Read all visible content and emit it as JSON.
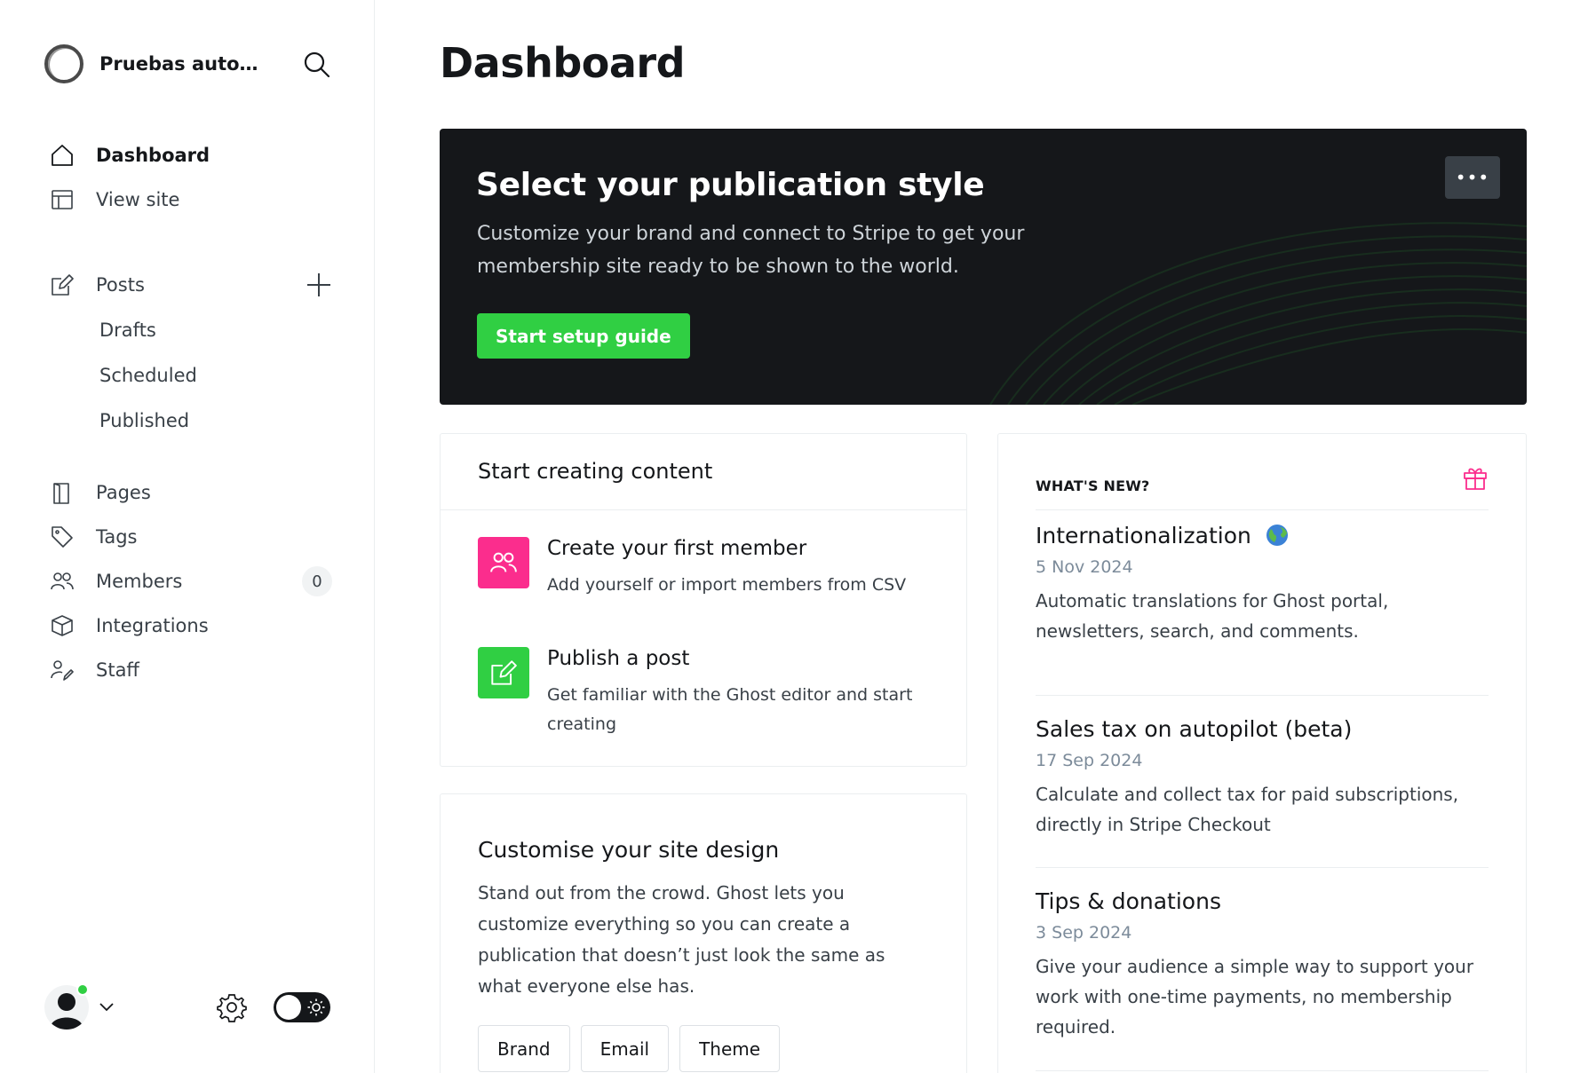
{
  "sidebar": {
    "site_name": "Pruebas automa...",
    "items": [
      {
        "label": "Dashboard",
        "icon": "home-icon"
      },
      {
        "label": "View site",
        "icon": "layout-icon"
      },
      {
        "label": "Posts",
        "icon": "edit-icon"
      },
      {
        "label": "Drafts"
      },
      {
        "label": "Scheduled"
      },
      {
        "label": "Published"
      },
      {
        "label": "Pages",
        "icon": "page-icon"
      },
      {
        "label": "Tags",
        "icon": "tag-icon"
      },
      {
        "label": "Members",
        "icon": "members-icon",
        "count": "0"
      },
      {
        "label": "Integrations",
        "icon": "cube-icon"
      },
      {
        "label": "Staff",
        "icon": "staff-icon"
      }
    ]
  },
  "main": {
    "title": "Dashboard",
    "hero": {
      "title": "Select your publication style",
      "description": "Customize your brand and connect to Stripe to get your membership site ready to be shown to the world.",
      "cta": "Start setup guide",
      "more": "•••"
    },
    "start_card": {
      "title": "Start creating content",
      "tasks": [
        {
          "title": "Create your first member",
          "description": "Add yourself or import members from CSV"
        },
        {
          "title": "Publish a post",
          "description": "Get familiar with the Ghost editor and start creating"
        }
      ]
    },
    "design_card": {
      "title": "Customise your site design",
      "description": "Stand out from the crowd. Ghost lets you customize everything so you can create a publication that doesn’t just look the same as what everyone else has.",
      "buttons": [
        "Brand",
        "Email",
        "Theme"
      ]
    },
    "whats_new": {
      "label": "WHAT'S NEW?",
      "items": [
        {
          "title": "Internationalization",
          "date": "5 Nov 2024",
          "description": "Automatic translations for Ghost portal, newsletters, search, and comments."
        },
        {
          "title": "Sales tax on autopilot (beta)",
          "date": "17 Sep 2024",
          "description": "Calculate and collect tax for paid subscriptions, directly in Stripe Checkout"
        },
        {
          "title": "Tips & donations",
          "date": "3 Sep 2024",
          "description": "Give your audience a simple way to support your work with one-time payments, no membership required."
        }
      ]
    }
  },
  "colors": {
    "accent_green": "#30cf43",
    "accent_pink": "#fb2d8d",
    "dark": "#15171a"
  }
}
